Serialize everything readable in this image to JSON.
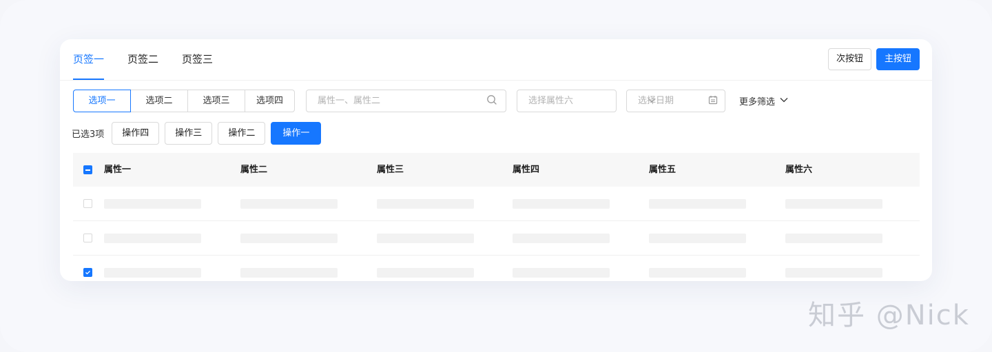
{
  "tabs": [
    {
      "label": "页签一",
      "active": true
    },
    {
      "label": "页签二",
      "active": false
    },
    {
      "label": "页签三",
      "active": false
    }
  ],
  "header_buttons": {
    "secondary": "次按钮",
    "primary": "主按钮"
  },
  "segments": [
    {
      "label": "选项一",
      "active": true
    },
    {
      "label": "选项二",
      "active": false
    },
    {
      "label": "选项三",
      "active": false
    },
    {
      "label": "选项四",
      "active": false
    }
  ],
  "search": {
    "placeholder": "属性一、属性二",
    "icon": "search-icon"
  },
  "select": {
    "placeholder": "选择属性六",
    "icon": "chevron-down-icon"
  },
  "date": {
    "placeholder": "选择日期",
    "icon": "calendar-icon"
  },
  "more_filters": {
    "label": "更多筛选",
    "icon": "chevron-down-icon"
  },
  "batch": {
    "selected_text": "已选3项",
    "actions": [
      "操作四",
      "操作三",
      "操作二",
      "操作一"
    ],
    "primary_action": "操作一"
  },
  "table": {
    "columns": [
      "属性一",
      "属性二",
      "属性三",
      "属性四",
      "属性五",
      "属性六"
    ],
    "header_checkbox": "indeterminate",
    "rows": [
      {
        "checked": false
      },
      {
        "checked": false
      },
      {
        "checked": true
      }
    ]
  },
  "watermark": "知乎 @Nick",
  "colors": {
    "primary": "#1677ff",
    "border": "#d9d9d9",
    "skeleton": "#f2f2f2",
    "header_bg": "#f7f7f7"
  }
}
